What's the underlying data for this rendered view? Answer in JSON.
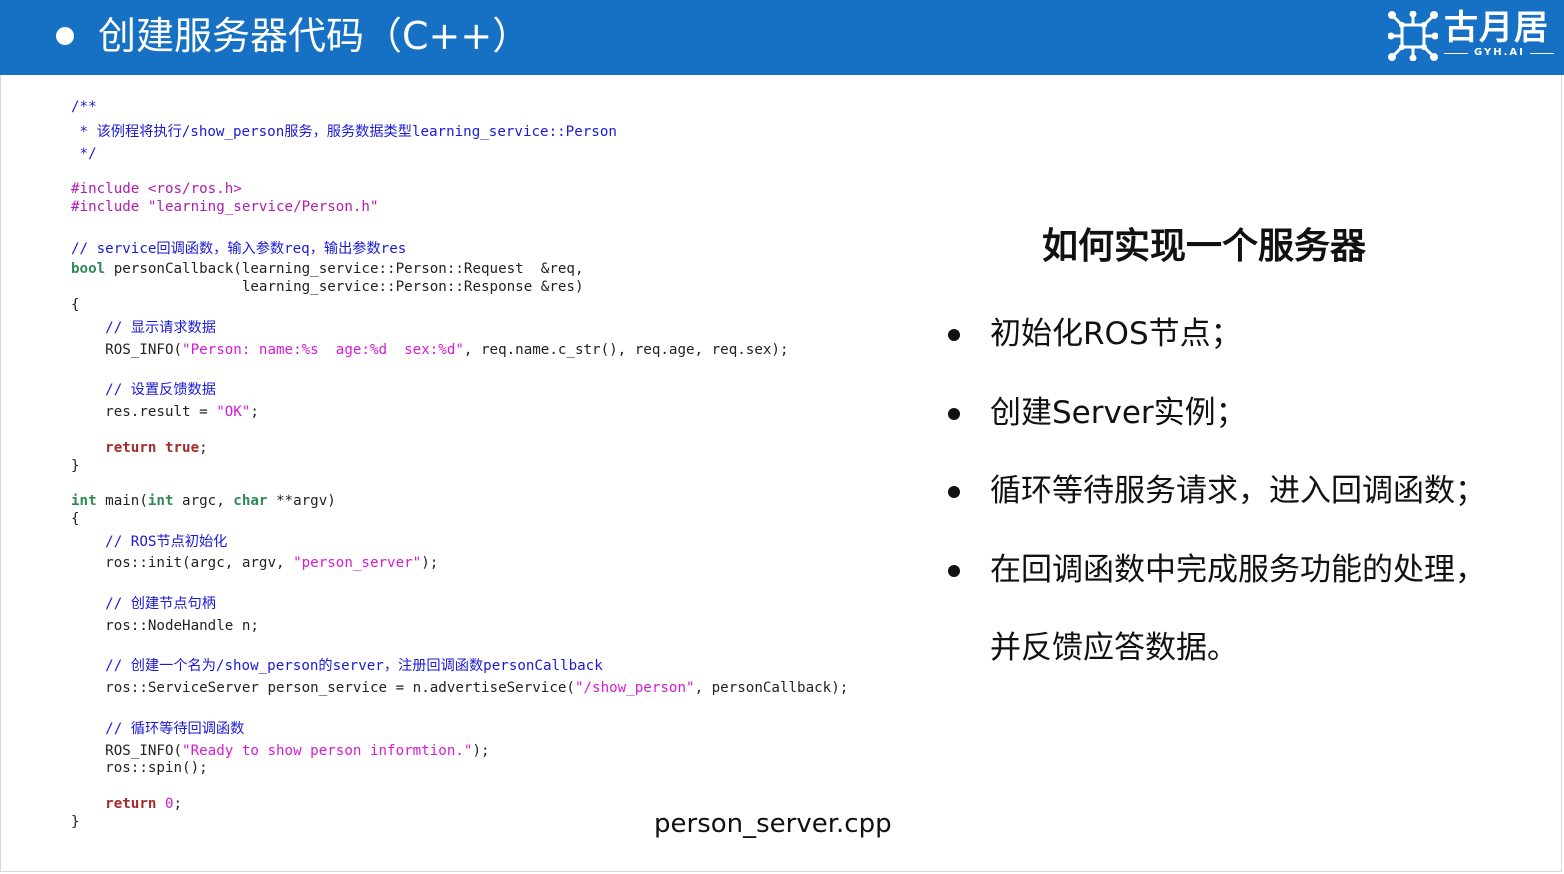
{
  "header": {
    "title": "创建服务器代码（C++）",
    "logo_text": "古月居",
    "logo_sub": "GYH.AI"
  },
  "code": {
    "lines": [
      [
        {
          "t": "/**",
          "c": "comment"
        }
      ],
      [
        {
          "t": " * 该例程将执行/show_person服务，服务数据类型learning_service::Person",
          "c": "comment"
        }
      ],
      [
        {
          "t": " */",
          "c": "comment"
        }
      ],
      [
        {
          "t": "#include ",
          "c": "pre"
        },
        {
          "t": "<ros/ros.h>",
          "c": "pre"
        }
      ],
      [
        {
          "t": "#include ",
          "c": "pre"
        },
        {
          "t": "\"learning_service/Person.h\"",
          "c": "pre"
        }
      ],
      [
        {
          "t": "// service回调函数，输入参数req，输出参数res",
          "c": "comment"
        }
      ],
      [
        {
          "t": "bool",
          "c": "type"
        },
        {
          "t": " personCallback(learning_service::Person::Request  &req,",
          "c": "plain"
        }
      ],
      [
        {
          "t": "                    learning_service::Person::Response &res)",
          "c": "plain"
        }
      ],
      [
        {
          "t": "{",
          "c": "plain"
        }
      ],
      [
        {
          "t": "    // 显示请求数据",
          "c": "comment"
        }
      ],
      [
        {
          "t": "    ROS_INFO(",
          "c": "plain"
        },
        {
          "t": "\"Person: name:%s  age:%d  sex:%d\"",
          "c": "str"
        },
        {
          "t": ", req.name.c_str(), req.age, req.sex);",
          "c": "plain"
        }
      ],
      [
        {
          "t": "    // 设置反馈数据",
          "c": "comment"
        }
      ],
      [
        {
          "t": "    res.result = ",
          "c": "plain"
        },
        {
          "t": "\"OK\"",
          "c": "str"
        },
        {
          "t": ";",
          "c": "plain"
        }
      ],
      [
        {
          "t": "    ",
          "c": "plain"
        },
        {
          "t": "return",
          "c": "kw"
        },
        {
          "t": " ",
          "c": "plain"
        },
        {
          "t": "true",
          "c": "kw"
        },
        {
          "t": ";",
          "c": "plain"
        }
      ],
      [
        {
          "t": "}",
          "c": "plain"
        }
      ],
      [
        {
          "t": "int",
          "c": "type"
        },
        {
          "t": " main(",
          "c": "plain"
        },
        {
          "t": "int",
          "c": "type"
        },
        {
          "t": " argc, ",
          "c": "plain"
        },
        {
          "t": "char",
          "c": "type"
        },
        {
          "t": " **argv)",
          "c": "plain"
        }
      ],
      [
        {
          "t": "{",
          "c": "plain"
        }
      ],
      [
        {
          "t": "    // ROS节点初始化",
          "c": "comment"
        }
      ],
      [
        {
          "t": "    ros::init(argc, argv, ",
          "c": "plain"
        },
        {
          "t": "\"person_server\"",
          "c": "str"
        },
        {
          "t": ");",
          "c": "plain"
        }
      ],
      [
        {
          "t": "    // 创建节点句柄",
          "c": "comment"
        }
      ],
      [
        {
          "t": "    ros::NodeHandle n;",
          "c": "plain"
        }
      ],
      [
        {
          "t": "    // 创建一个名为/show_person的server，注册回调函数personCallback",
          "c": "comment"
        }
      ],
      [
        {
          "t": "    ros::ServiceServer person_service = n.advertiseService(",
          "c": "plain"
        },
        {
          "t": "\"/show_person\"",
          "c": "str"
        },
        {
          "t": ", personCallback);",
          "c": "plain"
        }
      ],
      [
        {
          "t": "    // 循环等待回调函数",
          "c": "comment"
        }
      ],
      [
        {
          "t": "    ROS_INFO(",
          "c": "plain"
        },
        {
          "t": "\"Ready to show person informtion.\"",
          "c": "str"
        },
        {
          "t": ");",
          "c": "plain"
        }
      ],
      [
        {
          "t": "    ros::spin();",
          "c": "plain"
        }
      ],
      [
        {
          "t": "    ",
          "c": "plain"
        },
        {
          "t": "return",
          "c": "kw"
        },
        {
          "t": " ",
          "c": "plain"
        },
        {
          "t": "0",
          "c": "num"
        },
        {
          "t": ";",
          "c": "plain"
        }
      ],
      [
        {
          "t": "}",
          "c": "plain"
        }
      ]
    ]
  },
  "filename": "person_server.cpp",
  "right": {
    "heading": "如何实现一个服务器",
    "bullets": [
      "初始化ROS节点；",
      "创建Server实例；",
      "循环等待服务请求，进入回调函数；",
      "在回调函数中完成服务功能的处理，",
      "并反馈应答数据。"
    ]
  }
}
